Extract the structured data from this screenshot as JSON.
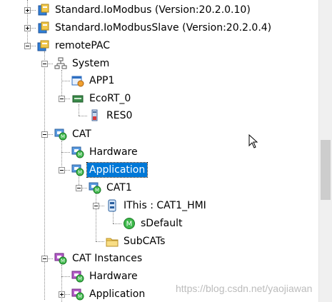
{
  "tree": {
    "items": [
      {
        "label": "Standard.IoModbus  (Version:20.2.0.10)",
        "icon": "library-icon",
        "expander": "plus"
      },
      {
        "label": "Standard.IoModbusSlave  (Version:20.2.0.4)",
        "icon": "library-icon",
        "expander": "plus"
      },
      {
        "label": "remotePAC",
        "icon": "project-icon",
        "expander": "minus"
      },
      {
        "label": "System",
        "icon": "network-icon",
        "expander": "minus"
      },
      {
        "label": "APP1",
        "icon": "app-icon",
        "expander": "none"
      },
      {
        "label": "EcoRT_0",
        "icon": "runtime-icon",
        "expander": "minus"
      },
      {
        "label": "RES0",
        "icon": "resource-icon",
        "expander": "none"
      },
      {
        "label": "CAT",
        "icon": "cat-icon",
        "expander": "minus"
      },
      {
        "label": "Hardware",
        "icon": "cat-icon",
        "expander": "none"
      },
      {
        "label": "Application",
        "icon": "cat-icon",
        "expander": "minus",
        "selected": true
      },
      {
        "label": "CAT1",
        "icon": "cat-icon",
        "expander": "minus"
      },
      {
        "label": "IThis : CAT1_HMI",
        "icon": "interface-icon",
        "expander": "minus"
      },
      {
        "label": "sDefault",
        "icon": "m-ball-icon",
        "expander": "none"
      },
      {
        "label": "SubCATs",
        "icon": "folder-icon",
        "expander": "none"
      },
      {
        "label": "CAT Instances",
        "icon": "cat-instances-icon",
        "expander": "minus"
      },
      {
        "label": "Hardware",
        "icon": "cat-instances-icon",
        "expander": "none"
      },
      {
        "label": "Application",
        "icon": "cat-instances-icon",
        "expander": "plus"
      }
    ]
  },
  "watermark": "https://blog.csdn.net/yaojiawan",
  "colors": {
    "selection": "#0078d7",
    "scrollbar_track": "#f0f0f0",
    "scrollbar_thumb": "#cdcdcd"
  }
}
